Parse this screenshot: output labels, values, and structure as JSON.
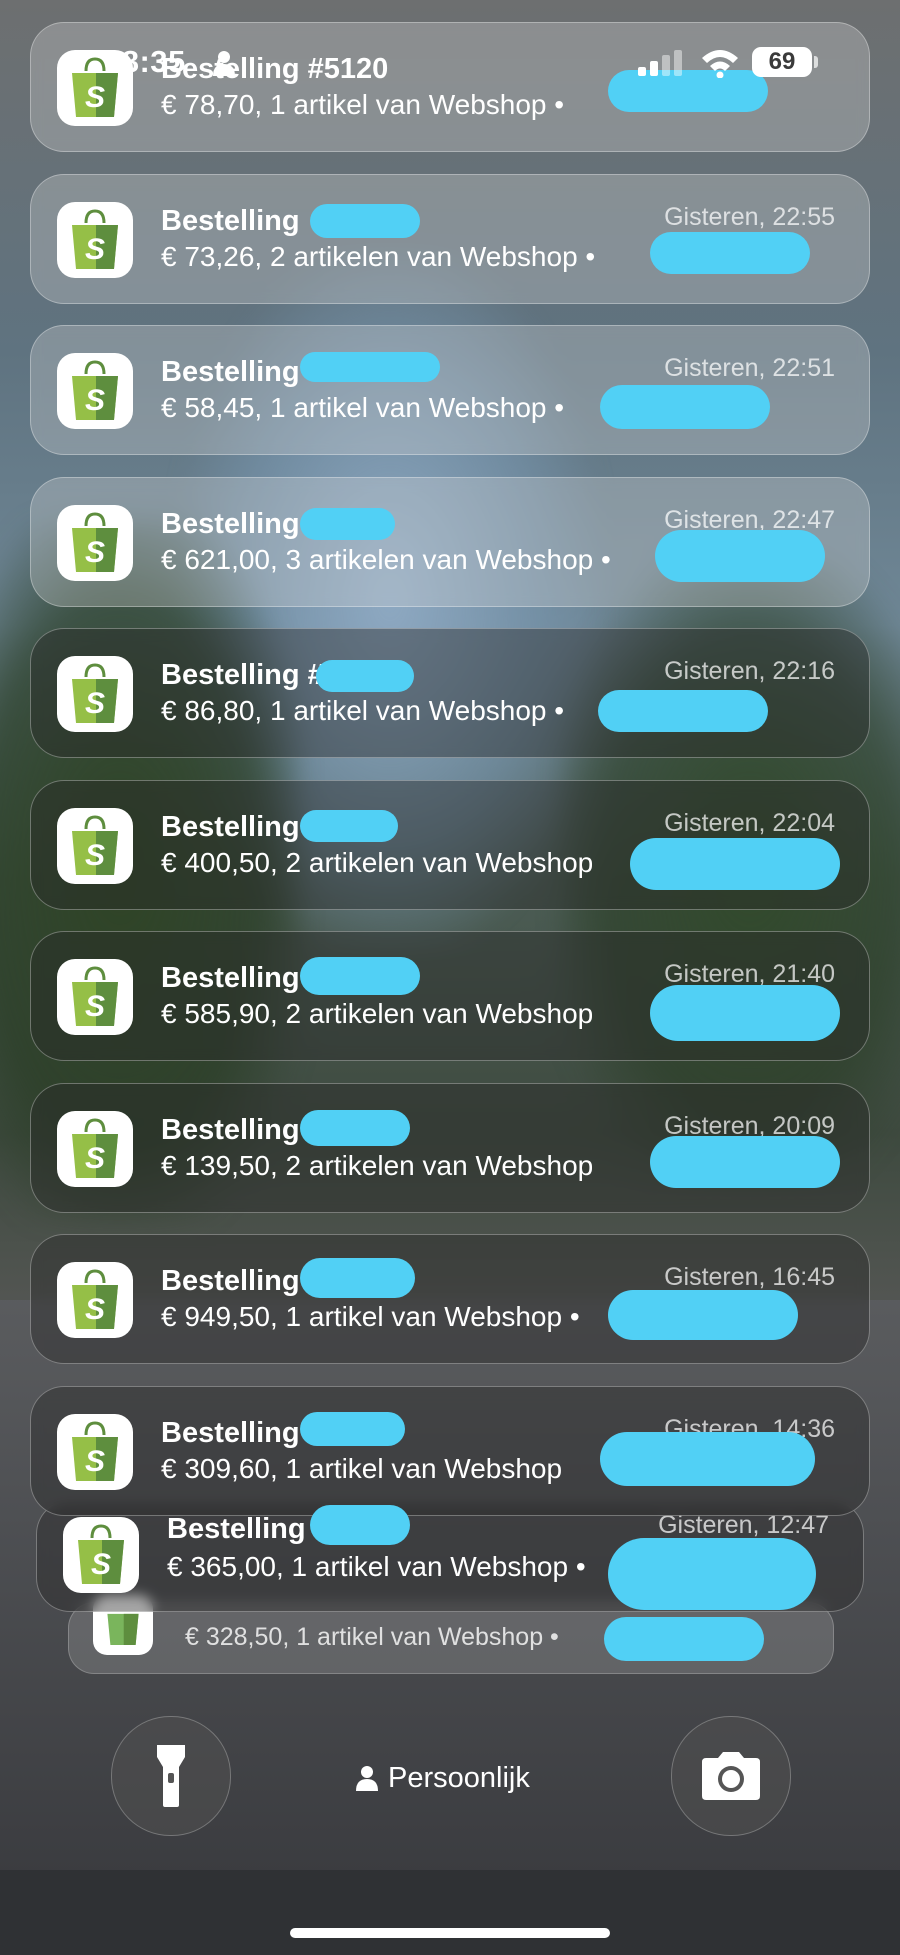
{
  "status_bar": {
    "time": "18:35",
    "battery": "69"
  },
  "notifications": [
    {
      "title": "Bestelling #5120",
      "body": "€ 78,70, 1 artikel van Webshop •",
      "time": ""
    },
    {
      "title": "Bestelling",
      "body": "€ 73,26, 2 artikelen van Webshop •",
      "time": "Gisteren, 22:55"
    },
    {
      "title": "Bestelling",
      "body": "€ 58,45, 1 artikel van Webshop •",
      "time": "Gisteren, 22:51"
    },
    {
      "title": "Bestelling #",
      "body": "€ 621,00, 3 artikelen van Webshop •",
      "time": "Gisteren, 22:47"
    },
    {
      "title": "Bestelling #",
      "body": "€ 86,80, 1 artikel van Webshop •",
      "time": "Gisteren, 22:16"
    },
    {
      "title": "Bestelling #",
      "body": "€ 400,50, 2 artikelen van Webshop",
      "time": "Gisteren, 22:04"
    },
    {
      "title": "Bestelling",
      "body": "€ 585,90, 2 artikelen van Webshop",
      "time": "Gisteren, 21:40"
    },
    {
      "title": "Bestelling",
      "body": "€ 139,50, 2 artikelen van Webshop",
      "time": "Gisteren, 20:09"
    },
    {
      "title": "Bestelling",
      "body": "€ 949,50, 1 artikel van Webshop •",
      "time": "Gisteren, 16:45"
    },
    {
      "title": "Bestelling",
      "body": "€ 309,60, 1 artikel van Webshop",
      "time": "Gisteren, 14:36"
    },
    {
      "title": "Bestelling #",
      "body": "€ 365,00, 1 artikel van Webshop •",
      "time": "Gisteren, 12:47"
    },
    {
      "title": "",
      "body": "€ 328,50, 1 artikel van Webshop •",
      "time": ""
    }
  ],
  "app_icon": "shopify-bag-icon",
  "focus_mode": {
    "label": "Persoonlijk"
  },
  "controls": {
    "left": "flashlight-icon",
    "right": "camera-icon"
  },
  "colors": {
    "redaction": "#51d0f5",
    "shopify_green": "#7ab55c"
  }
}
